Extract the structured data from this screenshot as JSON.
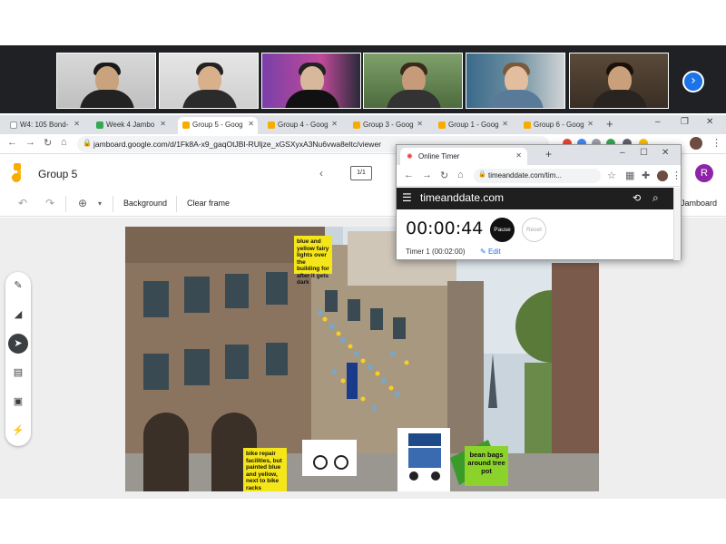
{
  "meeting": {
    "next_glyph": "›"
  },
  "browser": {
    "tabs": [
      {
        "label": "W4: 105 Bond-"
      },
      {
        "label": "Week 4 Jambo"
      },
      {
        "label": "Group 5 - Goog"
      },
      {
        "label": "Group 4 - Goog"
      },
      {
        "label": "Group 3 - Goog"
      },
      {
        "label": "Group 1 - Goog"
      },
      {
        "label": "Group 6 - Goog"
      }
    ],
    "newtab": "+",
    "url": "jamboard.google.com/d/1Fk8A-x9_gaqOtJBI-RUljze_xGSXyxA3Nu6vwa8eltc/viewer"
  },
  "jamboard": {
    "title": "Group 5",
    "frame_count": "1/1",
    "avatar_initial": "R",
    "toolbar": {
      "background": "Background",
      "clear": "Clear frame",
      "right_partial": "Jamboard"
    }
  },
  "stickies": {
    "lights": "blue and yellow fairy lights over the building for after it gets dark",
    "bike": "bike repair facilities, but painted blue and yellow, next to bike racks",
    "beanbags": "bean bags around tree pot"
  },
  "timer": {
    "tab_label": "Online Timer",
    "url": "timeanddate.com/tim...",
    "brand": "timeanddate.com",
    "time": "00:00:44",
    "pause": "Pause",
    "reset": "Reset",
    "label": "Timer 1 (00:02:00)",
    "edit": "Edit"
  },
  "colors": {
    "sticky_yellow": "#f5e61a",
    "sticky_green": "#8bd22b",
    "avatar_purple": "#8e24aa",
    "meet_dark": "#202124"
  }
}
